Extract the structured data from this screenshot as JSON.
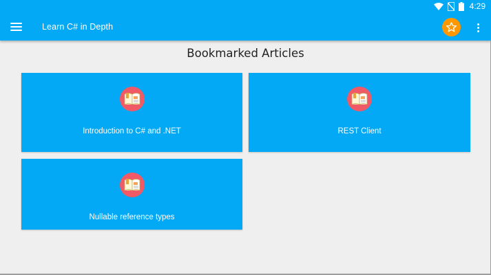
{
  "status_bar": {
    "time": "4:29",
    "icons": [
      "wifi-icon",
      "no-sim-icon",
      "battery-icon"
    ]
  },
  "toolbar": {
    "title": "Learn C# in Depth",
    "menu_icon": "hamburger-menu-icon",
    "favorite_icon": "star-icon",
    "overflow_icon": "more-vert-icon"
  },
  "page": {
    "heading": "Bookmarked Articles"
  },
  "articles": [
    {
      "title": "Introduction to C# and .NET",
      "icon": "open-book-icon"
    },
    {
      "title": "REST Client",
      "icon": "open-book-icon"
    },
    {
      "title": "Nullable reference types",
      "icon": "open-book-icon"
    }
  ],
  "colors": {
    "primary": "#03a9f4",
    "accent": "#ff9800",
    "icon_circle": "#ef5a66",
    "background": "#efefef"
  }
}
